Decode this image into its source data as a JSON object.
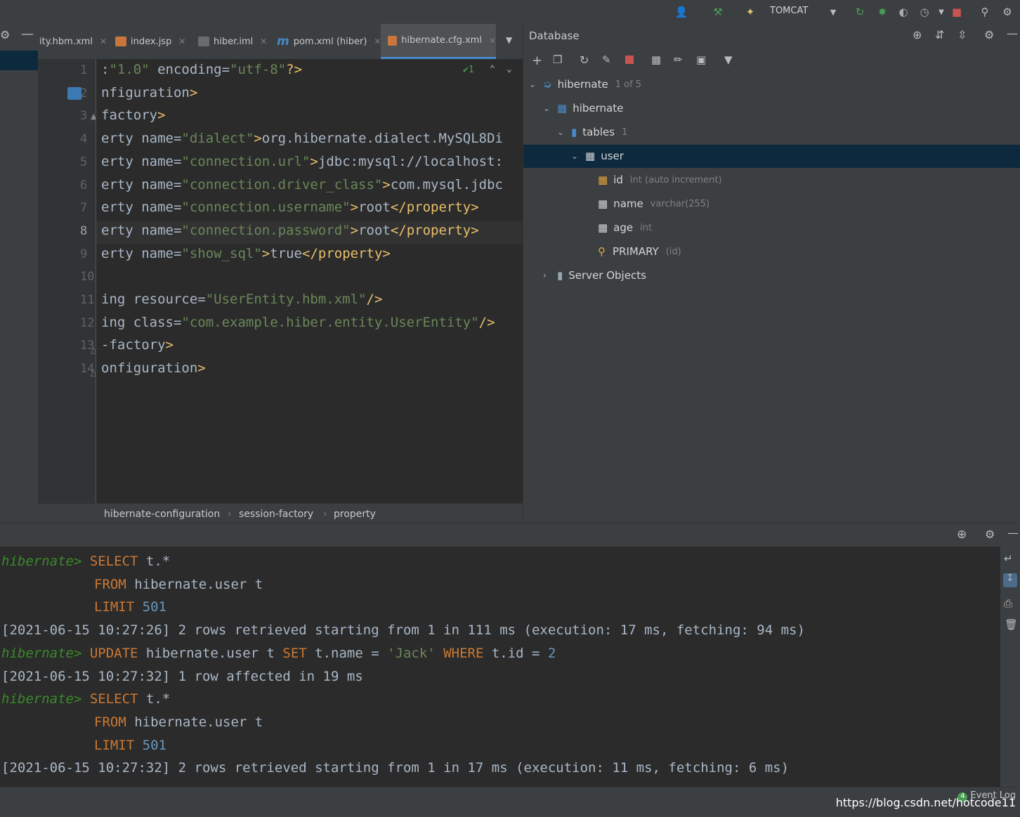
{
  "toolbar": {
    "run_config": "TOMCAT",
    "colors": {
      "build": "#499c54",
      "run": "#499c54",
      "stop": "#c75450"
    }
  },
  "tabs": [
    {
      "label": "ity.hbm.xml"
    },
    {
      "label": "index.jsp"
    },
    {
      "label": "hiber.iml"
    },
    {
      "label": "pom.xml (hiber)"
    },
    {
      "label": "hibernate.cfg.xml"
    }
  ],
  "editor": {
    "inspection_count": "1",
    "lines": [
      {
        "n": "1",
        "text": ":\"1.0\" encoding=\"utf-8\"?>"
      },
      {
        "n": "2",
        "text": "nfiguration>"
      },
      {
        "n": "3",
        "text": "factory>"
      },
      {
        "n": "4",
        "text": "erty name=\"dialect\">org.hibernate.dialect.MySQL8Di"
      },
      {
        "n": "5",
        "text": "erty name=\"connection.url\">jdbc:mysql://localhost:"
      },
      {
        "n": "6",
        "text": "erty name=\"connection.driver_class\">com.mysql.jdbc"
      },
      {
        "n": "7",
        "text": "erty name=\"connection.username\">root</property>"
      },
      {
        "n": "8",
        "text": "erty name=\"connection.password\">root</property>"
      },
      {
        "n": "9",
        "text": "erty name=\"show_sql\">true</property>"
      },
      {
        "n": "10",
        "text": ""
      },
      {
        "n": "11",
        "text": "ing resource=\"UserEntity.hbm.xml\"/>"
      },
      {
        "n": "12",
        "text": "ing class=\"com.example.hiber.entity.UserEntity\"/>"
      },
      {
        "n": "13",
        "text": "-factory>"
      },
      {
        "n": "14",
        "text": "onfiguration>"
      }
    ]
  },
  "breadcrumb": [
    "hibernate-configuration",
    "session-factory",
    "property"
  ],
  "database": {
    "title": "Database",
    "tree": {
      "datasource": "hibernate",
      "datasource_badge": "1 of 5",
      "schema": "hibernate",
      "tables_label": "tables",
      "tables_count": "1",
      "table": "user",
      "columns": [
        {
          "name": "id",
          "type": "int (auto increment)"
        },
        {
          "name": "name",
          "type": "varchar(255)"
        },
        {
          "name": "age",
          "type": "int"
        }
      ],
      "key": {
        "name": "PRIMARY",
        "cols": "(id)"
      },
      "server_objects": "Server Objects"
    }
  },
  "console": {
    "prompt": "hibernate>",
    "q1_select": "SELECT",
    "q1_select_rest": " t.*",
    "q1_from": "FROM",
    "q1_from_rest": " hibernate.user t",
    "q1_limit": "LIMIT",
    "q1_limit_val": "501",
    "log1": "[2021-06-15 10:27:26] 2 rows retrieved starting from 1 in 111 ms (execution: 17 ms, fetching: 94 ms)",
    "q2_update": "UPDATE",
    "q2_mid": " hibernate.user t ",
    "q2_set": "SET",
    "q2_assign": " t.name = ",
    "q2_str": "'Jack'",
    "q2_where": "WHERE",
    "q2_cond": " t.id = ",
    "q2_val": "2",
    "log2": "[2021-06-15 10:27:32] 1 row affected in 19 ms",
    "log3": "[2021-06-15 10:27:32] 2 rows retrieved starting from 1 in 17 ms (execution: 11 ms, fetching: 6 ms)"
  },
  "status": {
    "event_log_count": "4",
    "event_log": "Event Log",
    "watermark": "https://blog.csdn.net/hotcode11"
  }
}
